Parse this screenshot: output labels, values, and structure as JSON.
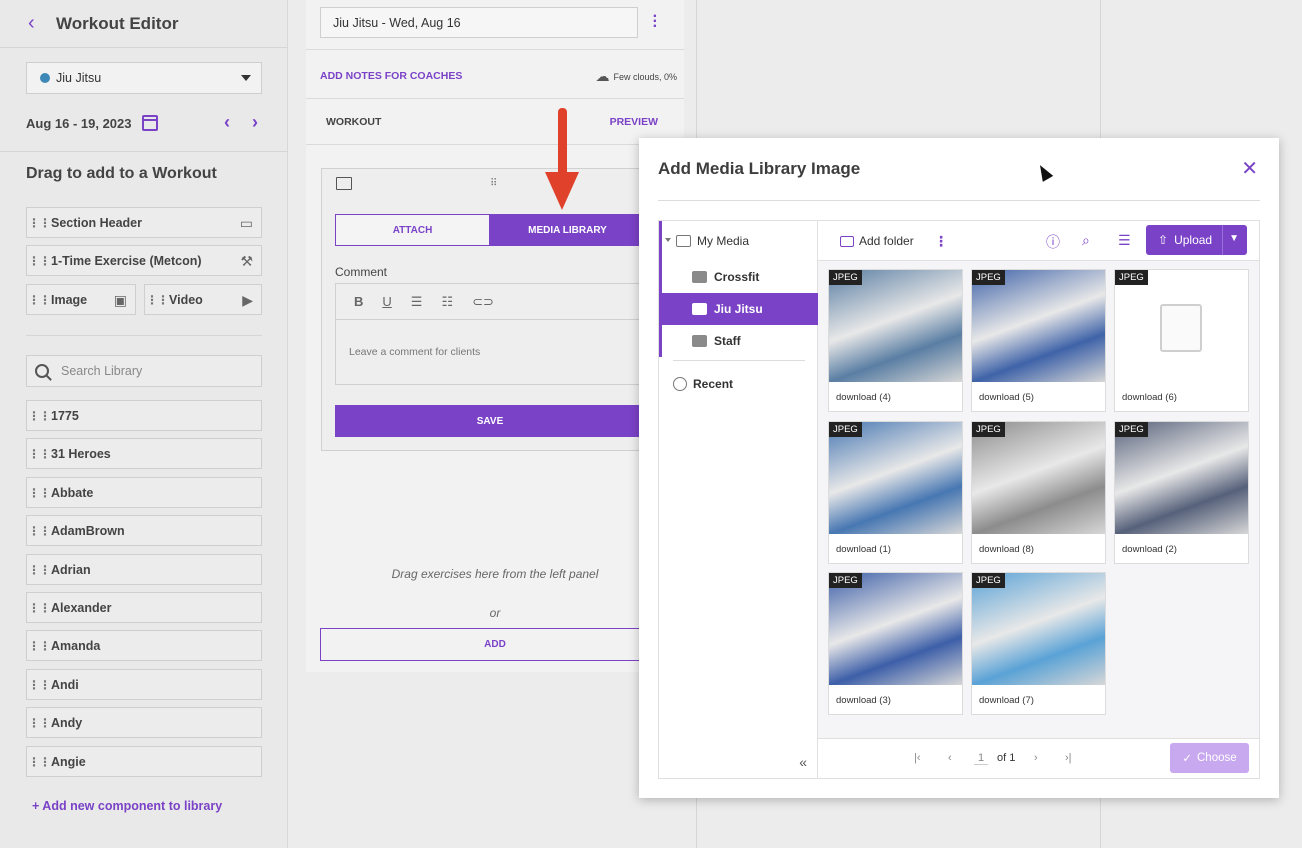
{
  "sidebar": {
    "title": "Workout Editor",
    "program": "Jiu Jitsu",
    "date_range": "Aug 16 - 19, 2023",
    "drag_heading": "Drag to add to a Workout",
    "components": {
      "section_header": "Section Header",
      "metcon": "1-Time Exercise (Metcon)",
      "image": "Image",
      "video": "Video"
    },
    "search_placeholder": "Search Library",
    "library": [
      "1775",
      "31 Heroes",
      "Abbate",
      "AdamBrown",
      "Adrian",
      "Alexander",
      "Amanda",
      "Andi",
      "Andy",
      "Angie"
    ],
    "add_new": "+ Add new component to library"
  },
  "workout": {
    "title": "Jiu Jitsu - Wed, Aug 16",
    "notes_link": "ADD NOTES FOR COACHES",
    "weather": "Few clouds, 0%",
    "workout_label": "WORKOUT",
    "preview_label": "PREVIEW",
    "tab_attach": "ATTACH",
    "tab_media": "MEDIA LIBRARY",
    "comment_label": "Comment",
    "comment_placeholder": "Leave a comment for clients",
    "save": "SAVE",
    "drag_hint": "Drag exercises here from the left panel",
    "or": "or",
    "add": "ADD"
  },
  "modal": {
    "title": "Add Media Library Image",
    "tree": {
      "root": "My Media",
      "folders": [
        "Crossfit",
        "Jiu Jitsu",
        "Staff"
      ],
      "active_folder": "Jiu Jitsu",
      "recent": "Recent"
    },
    "toolbar": {
      "add_folder": "Add folder",
      "upload": "Upload"
    },
    "images": [
      {
        "name": "download (4)",
        "type": "JPEG",
        "color": "#5a7ea3"
      },
      {
        "name": "download (5)",
        "type": "JPEG",
        "color": "#3f63a8"
      },
      {
        "name": "download (6)",
        "type": "JPEG",
        "color": ""
      },
      {
        "name": "download (1)",
        "type": "JPEG",
        "color": "#4777b2"
      },
      {
        "name": "download (8)",
        "type": "JPEG",
        "color": "#8c8c8c"
      },
      {
        "name": "download (2)",
        "type": "JPEG",
        "color": "#56617a"
      },
      {
        "name": "download (3)",
        "type": "JPEG",
        "color": "#3d5fa8"
      },
      {
        "name": "download (7)",
        "type": "JPEG",
        "color": "#5aa2d6"
      }
    ],
    "pager": {
      "page": "1",
      "of": "of 1"
    },
    "choose": "Choose"
  }
}
